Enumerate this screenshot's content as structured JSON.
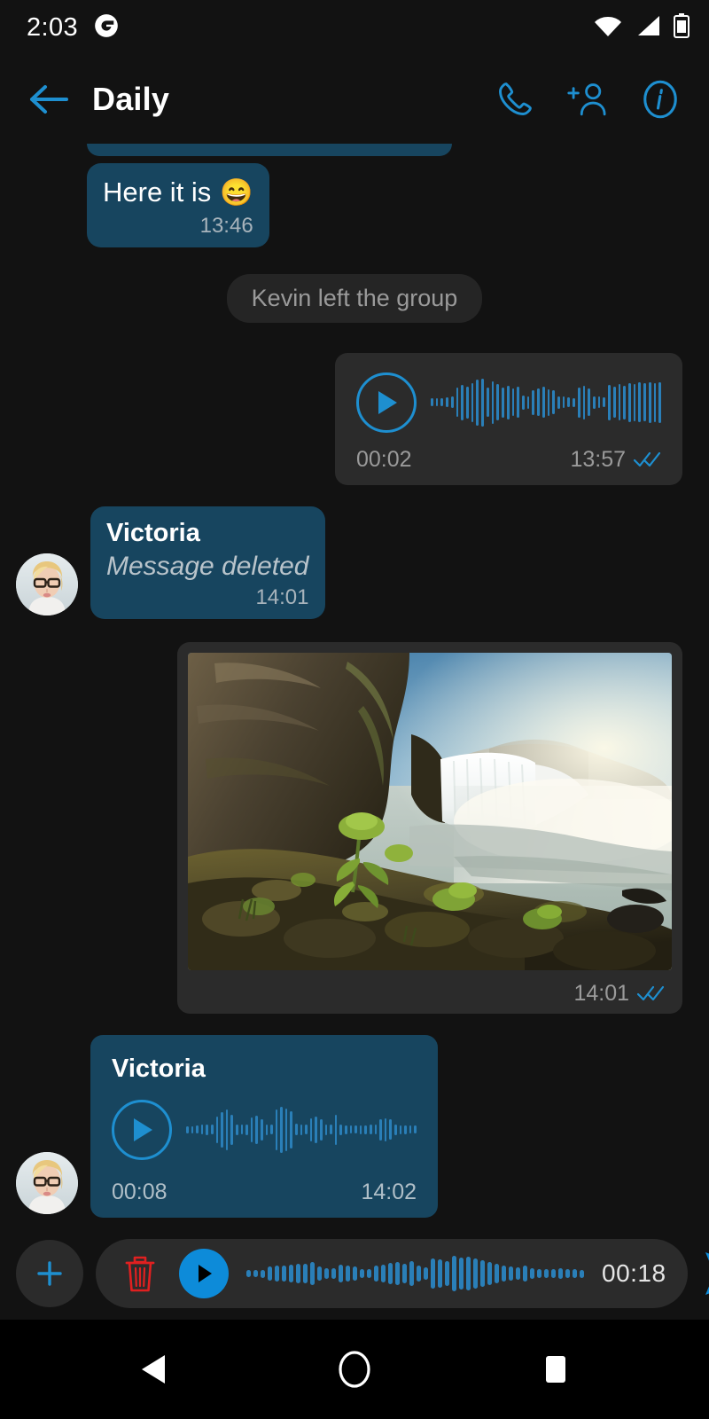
{
  "status_bar": {
    "time": "2:03",
    "icons": [
      "gmail-notification-icon",
      "wifi-icon",
      "signal-icon",
      "battery-icon"
    ]
  },
  "app_bar": {
    "back_label": "",
    "title": "Daily",
    "actions": [
      {
        "name": "call-button",
        "icon": "phone-icon"
      },
      {
        "name": "add-member-button",
        "icon": "add-person-icon"
      },
      {
        "name": "chat-info-button",
        "icon": "info-icon"
      }
    ]
  },
  "theme": {
    "background": "#121212",
    "bubble_incoming": "#17455f",
    "bubble_media": "#2b2b2b",
    "accent_blue": "#1e8fd0",
    "wave_blue": "#2a7fb8",
    "tick_blue": "#1e8fd0",
    "delete_red": "#e02020",
    "system_bubble": "#252525"
  },
  "messages": [
    {
      "id": "clipped-bubble",
      "type": "clipped",
      "align": "left"
    },
    {
      "id": "msg-text-here-it-is",
      "type": "text",
      "align": "left",
      "text": "Here it is",
      "emoji": "😄",
      "time": "13:46",
      "ticks": false
    },
    {
      "id": "msg-system-kevin",
      "type": "system",
      "align": "center",
      "text": "Kevin left the group"
    },
    {
      "id": "msg-voice-outgoing",
      "type": "voice",
      "align": "right",
      "sender": "",
      "duration": "00:02",
      "time": "13:57",
      "ticks": true,
      "style": "dark"
    },
    {
      "id": "msg-deleted-victoria",
      "type": "deleted",
      "align": "left",
      "sender": "Victoria",
      "text": "Message deleted",
      "time": "14:01",
      "ticks": false
    },
    {
      "id": "msg-image-waterfall",
      "type": "image",
      "align": "right",
      "alt": "waterfall-photo",
      "time": "14:01",
      "ticks": true
    },
    {
      "id": "msg-voice-victoria",
      "type": "voice",
      "align": "left",
      "sender": "Victoria",
      "duration": "00:08",
      "time": "14:02",
      "ticks": false,
      "style": "blue"
    }
  ],
  "composer": {
    "attach_label": "+",
    "delete_icon": "trash-icon",
    "play_icon": "play-icon",
    "recording_time": "00:18",
    "send_icon": "send-icon"
  },
  "nav_bar": {
    "back": "back-triangle-icon",
    "home": "home-circle-icon",
    "recents": "recents-square-icon"
  }
}
